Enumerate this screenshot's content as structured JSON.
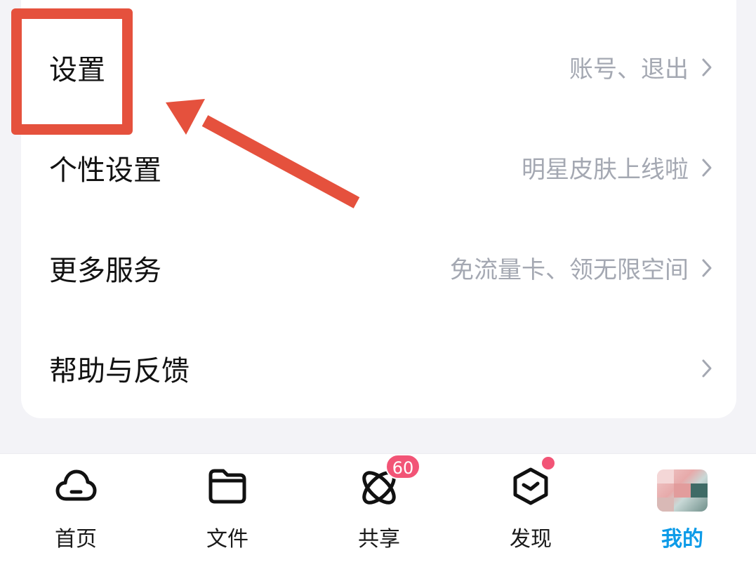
{
  "menu": {
    "items": [
      {
        "title": "设置",
        "subtitle": "账号、退出"
      },
      {
        "title": "个性设置",
        "subtitle": "明星皮肤上线啦"
      },
      {
        "title": "更多服务",
        "subtitle": "免流量卡、领无限空间"
      },
      {
        "title": "帮助与反馈",
        "subtitle": ""
      }
    ]
  },
  "tabbar": {
    "tabs": [
      {
        "label": "首页",
        "icon": "cloud-icon"
      },
      {
        "label": "文件",
        "icon": "folder-icon"
      },
      {
        "label": "共享",
        "icon": "orbit-icon",
        "badge": "60"
      },
      {
        "label": "发现",
        "icon": "hexagon-clock-icon"
      },
      {
        "label": "我的",
        "icon": "avatar",
        "active": true
      }
    ]
  },
  "colors": {
    "accent": "#0d9be8",
    "badge": "#f25476",
    "annotation": "#e5513d",
    "subtitle": "#a4a8b2"
  }
}
